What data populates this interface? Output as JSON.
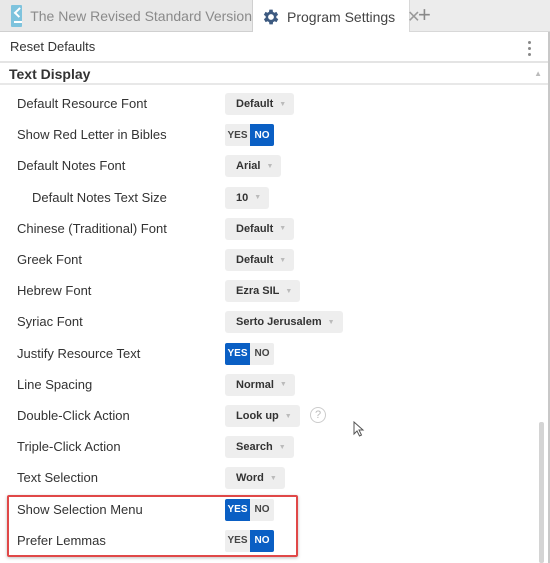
{
  "tabs": [
    {
      "label": "The New Revised Standard Version",
      "icon": "book-icon",
      "active": false
    },
    {
      "label": "Program Settings",
      "icon": "gear-icon",
      "active": true,
      "close_icon": "close-icon"
    }
  ],
  "add_tab_label": "+",
  "toolbar": {
    "reset_label": "Reset Defaults",
    "menu_icon": "kebab-menu-icon"
  },
  "section": {
    "title": "Text Display",
    "collapse_icon": "▲"
  },
  "settings": [
    {
      "label": "Default Resource Font",
      "type": "dropdown",
      "value": "Default"
    },
    {
      "label": "Show Red Letter in Bibles",
      "type": "toggle",
      "value": "NO"
    },
    {
      "label": "Default Notes Font",
      "type": "dropdown",
      "value": "Arial"
    },
    {
      "label": "Default Notes Text Size",
      "type": "dropdown",
      "value": "10",
      "indent": true
    },
    {
      "label": "Chinese (Traditional) Font",
      "type": "dropdown",
      "value": "Default"
    },
    {
      "label": "Greek Font",
      "type": "dropdown",
      "value": "Default"
    },
    {
      "label": "Hebrew Font",
      "type": "dropdown",
      "value": "Ezra SIL"
    },
    {
      "label": "Syriac Font",
      "type": "dropdown",
      "value": "Serto Jerusalem"
    },
    {
      "label": "Justify Resource Text",
      "type": "toggle",
      "value": "YES"
    },
    {
      "label": "Line Spacing",
      "type": "dropdown",
      "value": "Normal"
    },
    {
      "label": "Double-Click Action",
      "type": "dropdown",
      "value": "Look up",
      "help": "?"
    },
    {
      "label": "Triple-Click Action",
      "type": "dropdown",
      "value": "Search"
    },
    {
      "label": "Text Selection",
      "type": "dropdown",
      "value": "Word"
    },
    {
      "label": "Show Selection Menu",
      "type": "toggle",
      "value": "YES"
    },
    {
      "label": "Prefer Lemmas",
      "type": "toggle",
      "value": "NO"
    }
  ],
  "toggle_labels": {
    "yes": "YES",
    "no": "NO"
  },
  "caret": "▼",
  "colors": {
    "accent": "#0a5fc4",
    "highlight": "#e04848",
    "control_bg": "#eeeeee"
  }
}
